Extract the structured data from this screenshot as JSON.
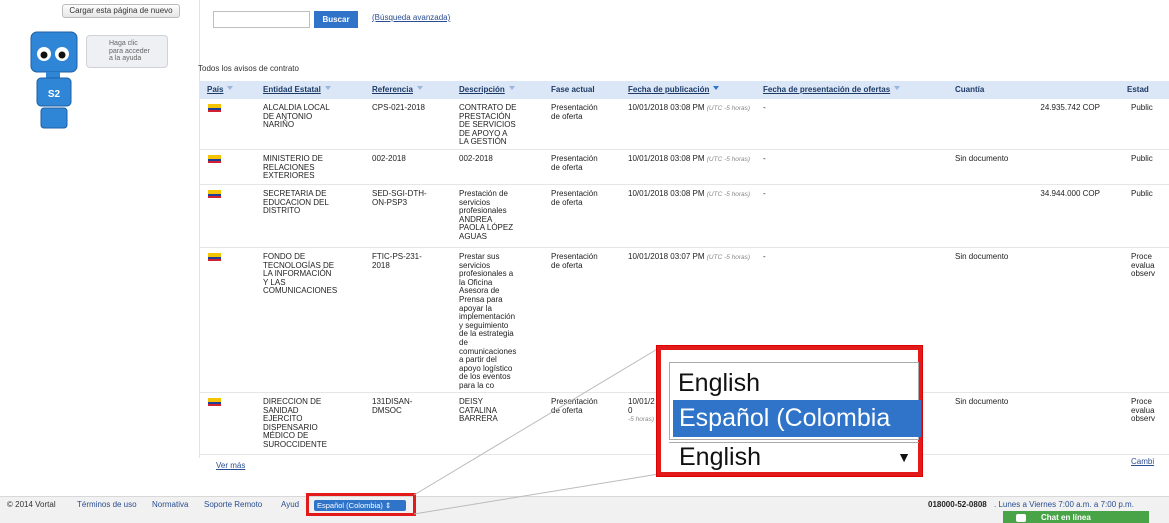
{
  "toolbar": {
    "reload_label": "Cargar esta página de nuevo",
    "search_value": "",
    "search_button": "Buscar",
    "advanced_search": "(Búsqueda avanzada)"
  },
  "assistant": {
    "help_text": "Haga clic\npara acceder\na la ayuda",
    "badge": "S2"
  },
  "list": {
    "heading": "Todos los avisos de contrato",
    "columns": [
      "País",
      "Entidad Estatal",
      "Referencia",
      "Descripción",
      "Fase actual",
      "Fecha de publicación",
      "Fecha de presentación de ofertas",
      "Cuantía",
      "Estad"
    ],
    "rows": [
      {
        "entity": "ALCALDIA LOCAL\nDE ANTONIO\nNARIÑO",
        "reference": "CPS-021-2018",
        "description": "CONTRATO DE\nPRESTACIÓN\nDE SERVICIOS\nDE APOYO A\nLA GESTIÓN",
        "phase": "Presentación\nde oferta",
        "published": "10/01/2018 03:08 PM",
        "tz": "(UTC -5 horas)",
        "offers": "-",
        "doc": "",
        "amount": "24.935.742 COP",
        "state": "Public"
      },
      {
        "entity": "MINISTERIO DE\nRELACIONES\nEXTERIORES",
        "reference": "002-2018",
        "description": "002-2018",
        "phase": "Presentación\nde oferta",
        "published": "10/01/2018 03:08 PM",
        "tz": "(UTC -5 horas)",
        "offers": "-",
        "doc": "Sin documento",
        "amount": "",
        "state": "Public"
      },
      {
        "entity": "SECRETARIA DE\nEDUCACION DEL\nDISTRITO",
        "reference": "SED-SGI-DTH-\nON-PSP3",
        "description": "Prestación de\nservicios\nprofesionales\nANDREA\nPAOLA LÓPEZ\nAGUAS",
        "phase": "Presentación\nde oferta",
        "published": "10/01/2018 03:08 PM",
        "tz": "(UTC -5 horas)",
        "offers": "-",
        "doc": "",
        "amount": "34.944.000 COP",
        "state": "Public"
      },
      {
        "entity": "FONDO DE\nTECNOLOGÍAS DE\nLA INFORMACIÓN\nY LAS\nCOMUNICACIONES",
        "reference": "FTIC-PS-231-\n2018",
        "description": "Prestar sus\nservicios\nprofesionales a\nla Oficina\nAsesora de\nPrensa para\napoyar la\nimplementación\ny seguimiento\nde la estrategia\nde\ncomunicaciones\na partir del\napoyo logístico\nde los eventos\npara la co",
        "phase": "Presentación\nde oferta",
        "published": "10/01/2018 03:07 PM",
        "tz": "(UTC -5 horas)",
        "offers": "-",
        "doc": "Sin documento",
        "amount": "",
        "state": "Proce\nevalua\nobserv"
      },
      {
        "entity": "DIRECCION DE\nSANIDAD\nEJERCITO\nDISPENSARIO\nMÉDICO DE\nSUROCCIDENTE",
        "reference": "131DISAN-\nDMSOC",
        "description": "DEISY\nCATALINA\nBARRERA",
        "phase": "Presentación\nde oferta",
        "published": "10/01/20",
        "tz": "-5 horas)",
        "offers": "",
        "doc": "Sin documento",
        "amount": "",
        "state": "Proce\nevalua\nobserv"
      }
    ],
    "see_more": "Ver más",
    "change": "Cambi"
  },
  "footer": {
    "copyright": "© 2014 Vortal",
    "links": [
      "Términos de uso",
      "Normativa",
      "Soporte Remoto",
      "Ayud"
    ],
    "language_selected": "Español (Colombia) ⇕",
    "phone": "018000-52-0808",
    "hours": ". Lunes a Viernes 7:00 a.m. a 7:00 p.m.",
    "chat": "Chat en línea"
  },
  "zoom_callout": {
    "option_1": "English",
    "option_2": "Español (Colombia",
    "select_value": "English"
  },
  "colors": {
    "accent": "#2f74c9",
    "header_bg": "#dbe7f6",
    "highlight": "#e21a1a",
    "chat": "#49a347"
  }
}
